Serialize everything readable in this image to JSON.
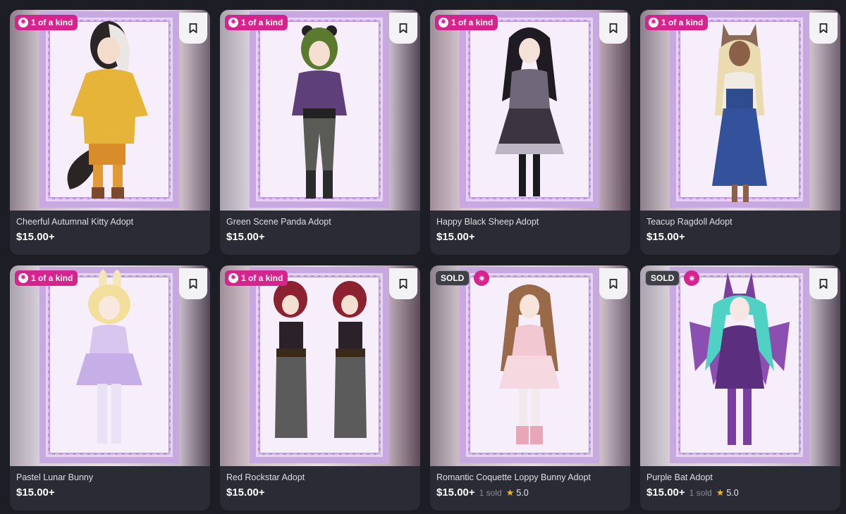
{
  "labels": {
    "one_of_a_kind": "1 of a kind",
    "sold": "SOLD",
    "sold_suffix": "sold"
  },
  "icons": {
    "sparkle": "sparkle-icon",
    "bookmark": "bookmark-icon",
    "star": "star-icon"
  },
  "colors": {
    "badge_pink": "#d6248f",
    "star_yellow": "#f2b90f",
    "card_bg": "#2b2b36",
    "page_bg": "#1d1d25"
  },
  "listings": [
    {
      "title": "Cheerful Autumnal Kitty Adopt",
      "price": "$15.00+",
      "one_of_a_kind": true,
      "sold": false,
      "sold_count": "",
      "rating": ""
    },
    {
      "title": "Green Scene Panda Adopt",
      "price": "$15.00+",
      "one_of_a_kind": true,
      "sold": false,
      "sold_count": "",
      "rating": ""
    },
    {
      "title": "Happy Black Sheep Adopt",
      "price": "$15.00+",
      "one_of_a_kind": true,
      "sold": false,
      "sold_count": "",
      "rating": ""
    },
    {
      "title": "Teacup Ragdoll Adopt",
      "price": "$15.00+",
      "one_of_a_kind": true,
      "sold": false,
      "sold_count": "",
      "rating": ""
    },
    {
      "title": "Pastel Lunar Bunny",
      "price": "$15.00+",
      "one_of_a_kind": true,
      "sold": false,
      "sold_count": "",
      "rating": ""
    },
    {
      "title": "Red Rockstar Adopt",
      "price": "$15.00+",
      "one_of_a_kind": true,
      "sold": false,
      "sold_count": "",
      "rating": ""
    },
    {
      "title": "Romantic Coquette Loppy Bunny Adopt",
      "price": "$15.00+",
      "one_of_a_kind": false,
      "sold": true,
      "sold_count": "1",
      "rating": "5.0"
    },
    {
      "title": "Purple Bat Adopt",
      "price": "$15.00+",
      "one_of_a_kind": false,
      "sold": true,
      "sold_count": "1",
      "rating": "5.0"
    }
  ]
}
